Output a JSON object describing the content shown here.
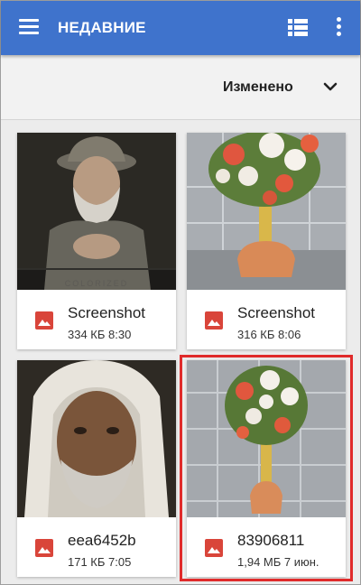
{
  "appbar": {
    "title": "НЕДАВНИЕ",
    "menu_icon": "hamburger-menu-icon",
    "view_icon": "list-view-icon",
    "more_icon": "more-vert-icon",
    "color": "#3f73cc"
  },
  "sortbar": {
    "label": "Изменено",
    "toggle_icon": "chevron-down-icon"
  },
  "files": [
    {
      "name": "Screenshot",
      "meta": "334 КБ 8:30",
      "icon": "image-file-icon"
    },
    {
      "name": "Screenshot",
      "meta": "316 КБ 8:06",
      "icon": "image-file-icon"
    },
    {
      "name": "eea6452b",
      "meta": "171 КБ 7:05",
      "icon": "image-file-icon"
    },
    {
      "name": "83906811",
      "meta": "1,94 МБ 7 июн.",
      "icon": "image-file-icon",
      "highlighted": true
    }
  ],
  "thumb_overlay_text": "COLORIZED",
  "colors": {
    "icon_red": "#d9453a",
    "highlight": "#e02b2b"
  }
}
